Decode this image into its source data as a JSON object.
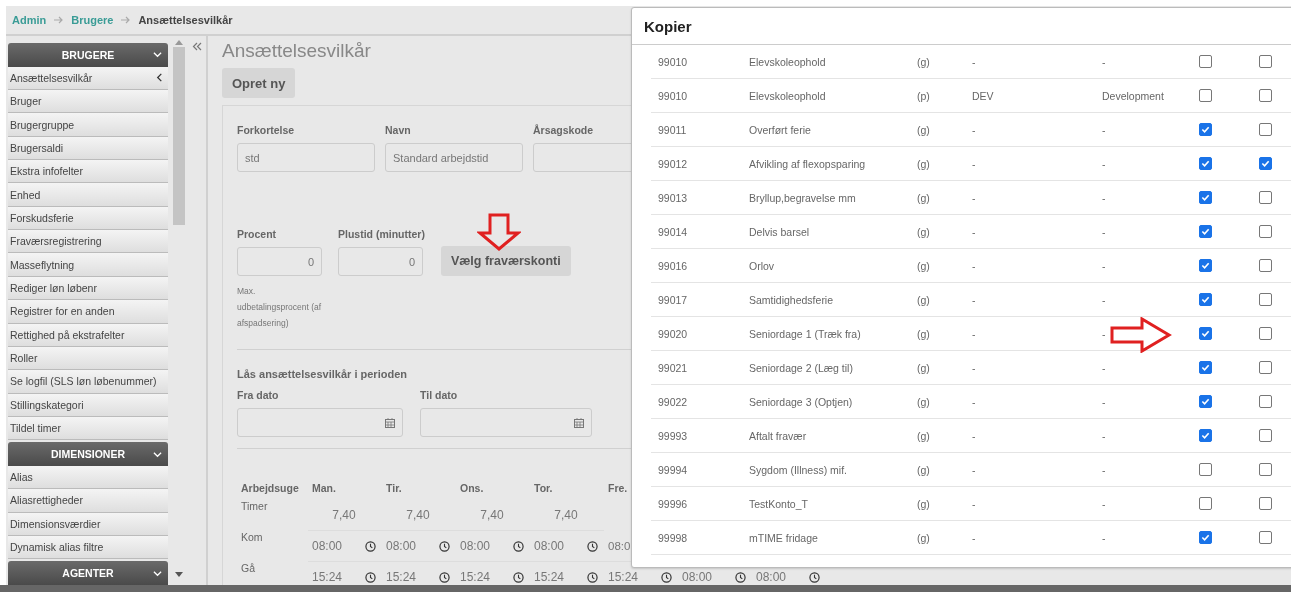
{
  "breadcrumb": [
    {
      "label": "Admin",
      "kind": "link"
    },
    {
      "label": "Brugere",
      "kind": "link"
    },
    {
      "label": "Ansættelsesvilkår",
      "kind": "current"
    }
  ],
  "sidebar": {
    "groups": [
      {
        "title": "BRUGERE",
        "items": [
          {
            "label": "Ansættelsesvilkår",
            "selected": true
          },
          {
            "label": "Bruger",
            "selected": false
          },
          {
            "label": "Brugergruppe",
            "selected": false
          },
          {
            "label": "Brugersaldi",
            "selected": false
          },
          {
            "label": "Ekstra infofelter",
            "selected": false
          },
          {
            "label": "Enhed",
            "selected": false
          },
          {
            "label": "Forskudsferie",
            "selected": false
          },
          {
            "label": "Fraværsregistrering",
            "selected": false
          },
          {
            "label": "Masseflytning",
            "selected": false
          },
          {
            "label": "Rediger løn løbenr",
            "selected": false
          },
          {
            "label": "Registrer for en anden",
            "selected": false
          },
          {
            "label": "Rettighed på ekstrafelter",
            "selected": false
          },
          {
            "label": "Roller",
            "selected": false
          },
          {
            "label": "Se logfil (SLS løn løbenummer)",
            "selected": false
          },
          {
            "label": "Stillingskategori",
            "selected": false
          },
          {
            "label": "Tildel timer",
            "selected": false
          }
        ]
      },
      {
        "title": "DIMENSIONER",
        "items": [
          {
            "label": "Alias",
            "selected": false
          },
          {
            "label": "Aliasrettigheder",
            "selected": false
          },
          {
            "label": "Dimensionsværdier",
            "selected": false
          },
          {
            "label": "Dynamisk alias filtre",
            "selected": false
          }
        ]
      },
      {
        "title": "AGENTER"
      }
    ]
  },
  "page": {
    "title": "Ansættelsesvilkår",
    "create_button": "Opret ny",
    "fields": [
      {
        "label": "Forkortelse",
        "value": "std"
      },
      {
        "label": "Navn",
        "value": "Standard arbejdstid"
      },
      {
        "label": "Årsagskode"
      }
    ],
    "percent": {
      "label": "Procent",
      "value": "0"
    },
    "extra_time": {
      "label": "Plustid (minutter)",
      "value": "0"
    },
    "choose_button": "Vælg fraværskonti",
    "percent_hint": [
      "Max.",
      "udbetalingsprocent (af",
      "afspadsering)"
    ],
    "lock_title": "Lås ansættelsesvilkår i perioden",
    "dates": [
      {
        "label": "Fra dato"
      },
      {
        "label": "Til dato"
      }
    ],
    "week": {
      "label": "Arbejdsuge",
      "days": [
        "Man.",
        "Tir.",
        "Ons.",
        "Tor.",
        "Fre."
      ],
      "rows": [
        {
          "label": "Timer",
          "kind": "hours",
          "values": [
            {
              "text": "7,40"
            },
            {
              "text": "7,40"
            },
            {
              "text": "7,40"
            },
            {
              "text": "7,40"
            }
          ]
        },
        {
          "label": "Kom",
          "kind": "time",
          "values": [
            {
              "text": "08:00",
              "clock": true
            },
            {
              "text": "08:00",
              "clock": true
            },
            {
              "text": "08:00",
              "clock": true
            },
            {
              "text": "08:00",
              "clock": true
            },
            {
              "text": "08:0",
              "clock": false
            }
          ]
        },
        {
          "label": "Gå",
          "kind": "time",
          "values": [
            {
              "text": "15:24",
              "clock": true
            },
            {
              "text": "15:24",
              "clock": true
            },
            {
              "text": "15:24",
              "clock": true
            },
            {
              "text": "15:24",
              "clock": true
            },
            {
              "text": "15:24",
              "clock": true
            },
            {
              "text": "08:00",
              "clock": true
            },
            {
              "text": "08:00",
              "clock": true
            }
          ]
        }
      ]
    }
  },
  "dialog": {
    "title": "Kopier",
    "rows": [
      {
        "code": "99010",
        "name": "Elevskoleophold",
        "type": "(g)",
        "column_4": "-",
        "column_5": "-",
        "column_6_checked": false,
        "column_7_checked": false
      },
      {
        "code": "99010",
        "name": "Elevskoleophold",
        "type": "(p)",
        "column_4": "DEV",
        "column_5": "Development",
        "column_6_checked": false,
        "column_7_checked": false
      },
      {
        "code": "99011",
        "name": "Overført ferie",
        "type": "(g)",
        "column_4": "-",
        "column_5": "-",
        "column_6_checked": true,
        "column_7_checked": false
      },
      {
        "code": "99012",
        "name": "Afvikling af flexopsparing",
        "type": "(g)",
        "column_4": "-",
        "column_5": "-",
        "column_6_checked": true,
        "column_7_checked": true
      },
      {
        "code": "99013",
        "name": "Bryllup,begravelse mm",
        "type": "(g)",
        "column_4": "-",
        "column_5": "-",
        "column_6_checked": true,
        "column_7_checked": false
      },
      {
        "code": "99014",
        "name": "Delvis barsel",
        "type": "(g)",
        "column_4": "-",
        "column_5": "-",
        "column_6_checked": true,
        "column_7_checked": false
      },
      {
        "code": "99016",
        "name": "Orlov",
        "type": "(g)",
        "column_4": "-",
        "column_5": "-",
        "column_6_checked": true,
        "column_7_checked": false
      },
      {
        "code": "99017",
        "name": "Samtidighedsferie",
        "type": "(g)",
        "column_4": "-",
        "column_5": "-",
        "column_6_checked": true,
        "column_7_checked": false
      },
      {
        "code": "99020",
        "name": "Seniordage 1 (Træk fra)",
        "type": "(g)",
        "column_4": "-",
        "column_5": "-",
        "column_6_checked": true,
        "column_7_checked": false
      },
      {
        "code": "99021",
        "name": "Seniordage 2 (Læg til)",
        "type": "(g)",
        "column_4": "-",
        "column_5": "-",
        "column_6_checked": true,
        "column_7_checked": false
      },
      {
        "code": "99022",
        "name": "Seniordage 3 (Optjen)",
        "type": "(g)",
        "column_4": "-",
        "column_5": "-",
        "column_6_checked": true,
        "column_7_checked": false
      },
      {
        "code": "99993",
        "name": "Aftalt fravær",
        "type": "(g)",
        "column_4": "-",
        "column_5": "-",
        "column_6_checked": true,
        "column_7_checked": false
      },
      {
        "code": "99994",
        "name": "Sygdom (Illness) mif.",
        "type": "(g)",
        "column_4": "-",
        "column_5": "-",
        "column_6_checked": false,
        "column_7_checked": false
      },
      {
        "code": "99996",
        "name": "TestKonto_T",
        "type": "(g)",
        "column_4": "-",
        "column_5": "-",
        "column_6_checked": false,
        "column_7_checked": false
      },
      {
        "code": "99998",
        "name": "mTIME fridage",
        "type": "(g)",
        "column_4": "-",
        "column_5": "-",
        "column_6_checked": true,
        "column_7_checked": false
      }
    ]
  }
}
